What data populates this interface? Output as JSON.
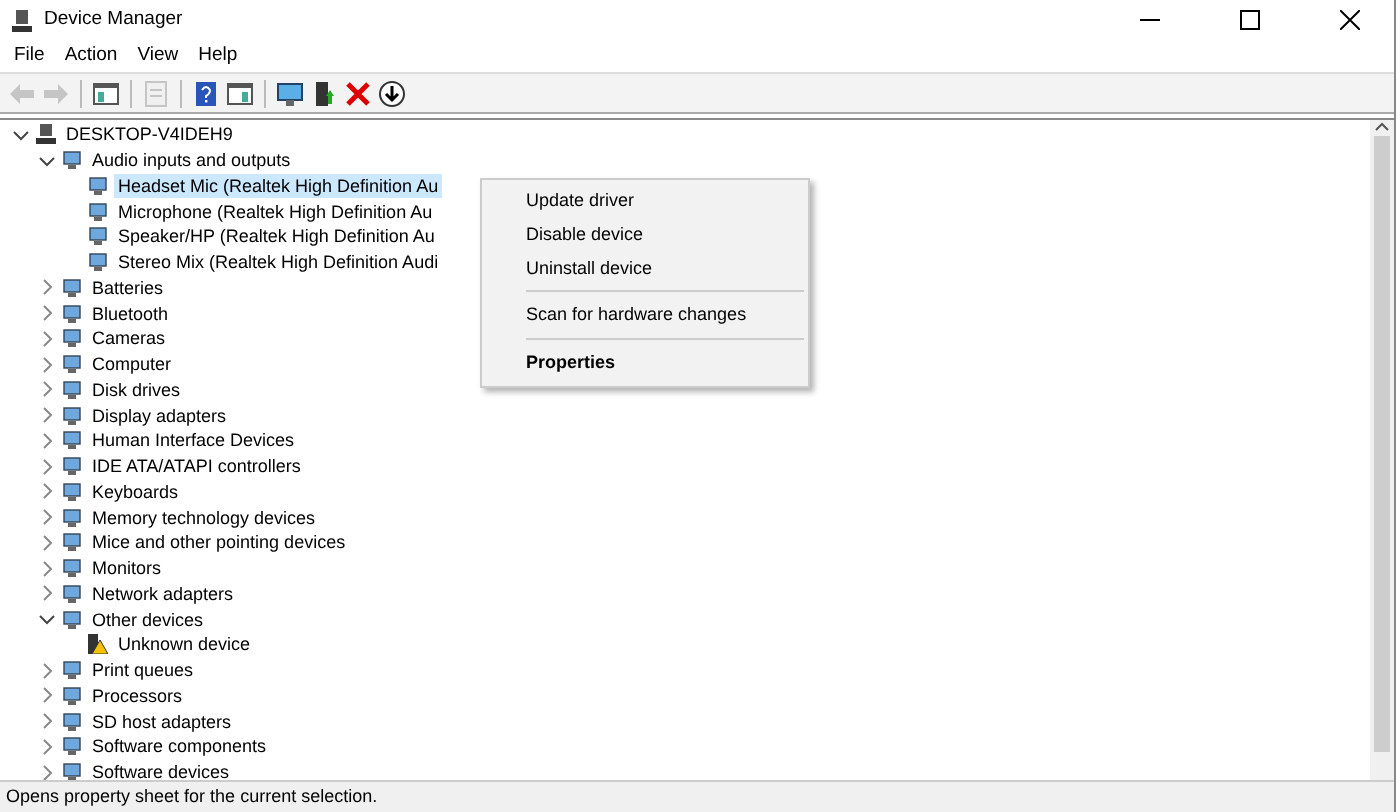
{
  "window": {
    "title": "Device Manager"
  },
  "menu": [
    "File",
    "Action",
    "View",
    "Help"
  ],
  "toolbar": [
    {
      "kind": "back",
      "disabled": true
    },
    {
      "kind": "forward",
      "disabled": true
    },
    {
      "kind": "sep"
    },
    {
      "kind": "console",
      "disabled": false
    },
    {
      "kind": "sep"
    },
    {
      "kind": "properties",
      "disabled": true
    },
    {
      "kind": "sep"
    },
    {
      "kind": "help",
      "disabled": false
    },
    {
      "kind": "pane",
      "disabled": false
    },
    {
      "kind": "sep"
    },
    {
      "kind": "scan",
      "disabled": false
    },
    {
      "kind": "update",
      "disabled": false
    },
    {
      "kind": "uninstall",
      "disabled": false
    },
    {
      "kind": "download",
      "disabled": false
    }
  ],
  "tree": {
    "label": "DESKTOP-V4IDEH9",
    "expanded": true,
    "children": [
      {
        "label": "Audio inputs and outputs",
        "expanded": true,
        "children": [
          {
            "label": "Headset Mic (Realtek High Definition Au",
            "selected": true,
            "warning": false
          },
          {
            "label": "Microphone (Realtek High Definition Au",
            "selected": false,
            "warning": false
          },
          {
            "label": "Speaker/HP (Realtek High Definition Au",
            "selected": false,
            "warning": false
          },
          {
            "label": "Stereo Mix (Realtek High Definition Audi",
            "selected": false,
            "warning": false
          }
        ]
      },
      {
        "label": "Batteries",
        "expanded": false
      },
      {
        "label": "Bluetooth",
        "expanded": false
      },
      {
        "label": "Cameras",
        "expanded": false
      },
      {
        "label": "Computer",
        "expanded": false
      },
      {
        "label": "Disk drives",
        "expanded": false
      },
      {
        "label": "Display adapters",
        "expanded": false
      },
      {
        "label": "Human Interface Devices",
        "expanded": false
      },
      {
        "label": "IDE ATA/ATAPI controllers",
        "expanded": false
      },
      {
        "label": "Keyboards",
        "expanded": false
      },
      {
        "label": "Memory technology devices",
        "expanded": false
      },
      {
        "label": "Mice and other pointing devices",
        "expanded": false
      },
      {
        "label": "Monitors",
        "expanded": false
      },
      {
        "label": "Network adapters",
        "expanded": false
      },
      {
        "label": "Other devices",
        "expanded": true,
        "children": [
          {
            "label": "Unknown device",
            "selected": false,
            "warning": true
          }
        ]
      },
      {
        "label": "Print queues",
        "expanded": false
      },
      {
        "label": "Processors",
        "expanded": false
      },
      {
        "label": "SD host adapters",
        "expanded": false
      },
      {
        "label": "Software components",
        "expanded": false
      },
      {
        "label": "Software devices",
        "expanded": false
      }
    ]
  },
  "context_menu": [
    {
      "label": "Update driver",
      "separator_before": false,
      "default": false
    },
    {
      "label": "Disable device",
      "separator_before": false,
      "default": false
    },
    {
      "label": "Uninstall device",
      "separator_before": false,
      "default": false
    },
    {
      "label": "Scan for hardware changes",
      "separator_before": true,
      "default": false
    },
    {
      "label": "Properties",
      "separator_before": true,
      "default": true
    }
  ],
  "status_bar": "Opens property sheet for the current selection."
}
